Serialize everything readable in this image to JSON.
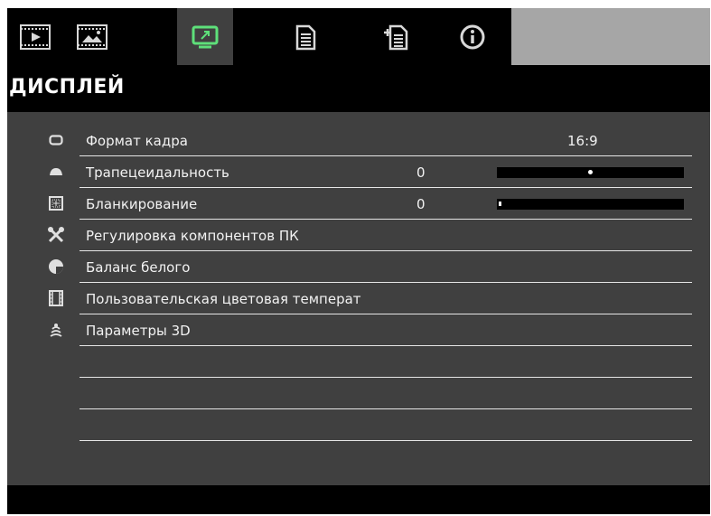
{
  "tabs": [
    {
      "icon": "video-icon"
    },
    {
      "icon": "image-icon"
    },
    {
      "icon": "display-icon",
      "active": true
    },
    {
      "icon": "settings-doc-icon"
    },
    {
      "icon": "settings-doc-plus-icon"
    },
    {
      "icon": "info-icon"
    }
  ],
  "page": {
    "title": "ДИСПЛЕЙ"
  },
  "menu": {
    "items": [
      {
        "icon": "aspect-ratio-icon",
        "label": "Формат кадра",
        "value": "16:9"
      },
      {
        "icon": "keystone-icon",
        "label": "Трапецеидальность",
        "value": "0",
        "level": 0.5
      },
      {
        "icon": "blanking-icon",
        "label": "Бланкирование",
        "value": "0",
        "level": 0.0
      },
      {
        "icon": "tools-icon",
        "label": "Регулировка компонентов ПК"
      },
      {
        "icon": "white-balance-icon",
        "label": "Баланс белого"
      },
      {
        "icon": "film-icon",
        "label": "Пользовательская цветовая температ"
      },
      {
        "icon": "3d-icon",
        "label": "Параметры 3D"
      }
    ]
  },
  "colors": {
    "accent": "#5ee07a",
    "background": "#404040",
    "bar": "#000000"
  }
}
